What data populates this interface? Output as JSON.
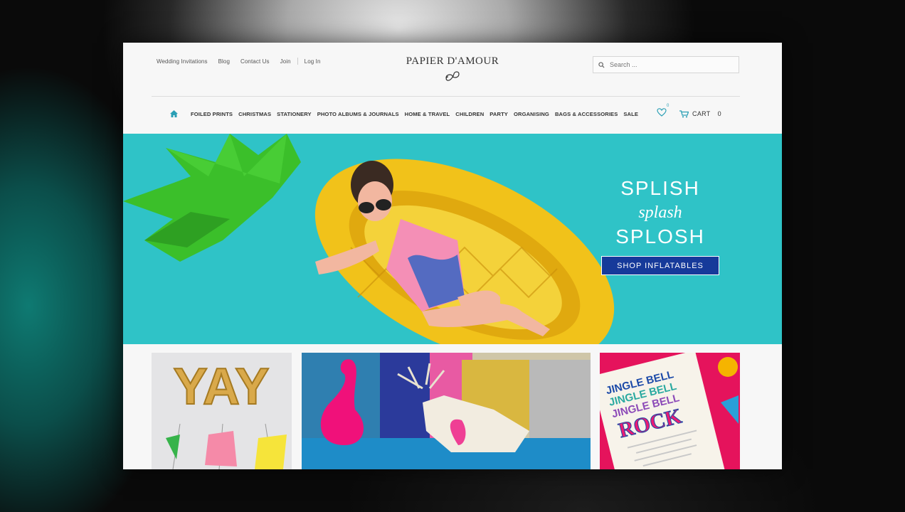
{
  "header": {
    "top_links": [
      "Wedding Invitations",
      "Blog",
      "Contact Us",
      "Join",
      "Log In"
    ],
    "logo": "PAPIER D'AMOUR",
    "search_placeholder": "Search ..."
  },
  "nav": {
    "items": [
      "FOILED PRINTS",
      "CHRISTMAS",
      "STATIONERY",
      "PHOTO ALBUMS & JOURNALS",
      "HOME & TRAVEL",
      "CHILDREN",
      "PARTY",
      "ORGANISING",
      "BAGS & ACCESSORIES",
      "SALE"
    ],
    "wishlist_count": "0",
    "cart_label": "CART",
    "cart_count": "0"
  },
  "hero": {
    "line1": "SPLISH",
    "line2": "splash",
    "line3": "SPLOSH",
    "cta": "SHOP INFLATABLES"
  },
  "tiles": {
    "tile1_text": "YAY",
    "tile3_lines": [
      "JINGLE BELL",
      "JINGLE BELL",
      "JINGLE BELL",
      "ROCK"
    ]
  },
  "colors": {
    "hero_bg": "#2fc3c7",
    "cta_bg": "#163a9a",
    "accent": "#2a9fb5"
  }
}
